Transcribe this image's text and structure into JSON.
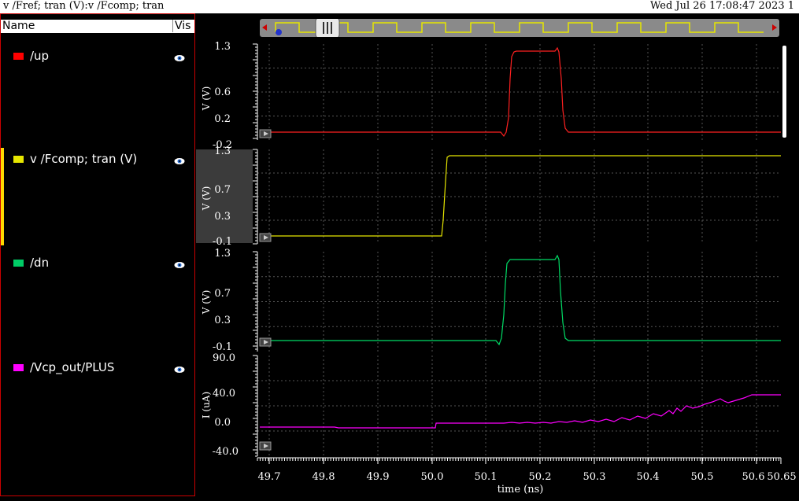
{
  "titlebar": {
    "left": "v /Fref; tran (V):v /Fcomp; tran",
    "right": "Wed Jul 26 17:08:47 2023   1"
  },
  "panel": {
    "header_name": "Name",
    "header_vis": "Vis",
    "signals": [
      {
        "label": "/up",
        "color": "#ff0000"
      },
      {
        "label": "v /Fcomp; tran (V)",
        "color": "#e6e600"
      },
      {
        "label": "/dn",
        "color": "#00cc66"
      },
      {
        "label": "/Vcp_out/PLUS",
        "color": "#ff00ff"
      }
    ]
  },
  "strips": [
    {
      "ylabel": "V (V)",
      "ticks": [
        "1.3",
        "0.6",
        "0.2",
        "-0.2"
      ]
    },
    {
      "ylabel": "V (V)",
      "ticks": [
        "1.3",
        "0.7",
        "0.3",
        "-0.1"
      ]
    },
    {
      "ylabel": "V (V)",
      "ticks": [
        "1.3",
        "0.7",
        "0.3",
        "-0.1"
      ]
    },
    {
      "ylabel": "I (uA)",
      "ticks": [
        "90.0",
        "40.0",
        "0.0",
        "-40.0"
      ]
    }
  ],
  "xaxis": {
    "label": "time (ns)",
    "ticks": [
      "49.7",
      "49.8",
      "49.9",
      "50.0",
      "50.1",
      "50.2",
      "50.3",
      "50.4",
      "50.5",
      "50.6",
      "50.65"
    ]
  }
}
